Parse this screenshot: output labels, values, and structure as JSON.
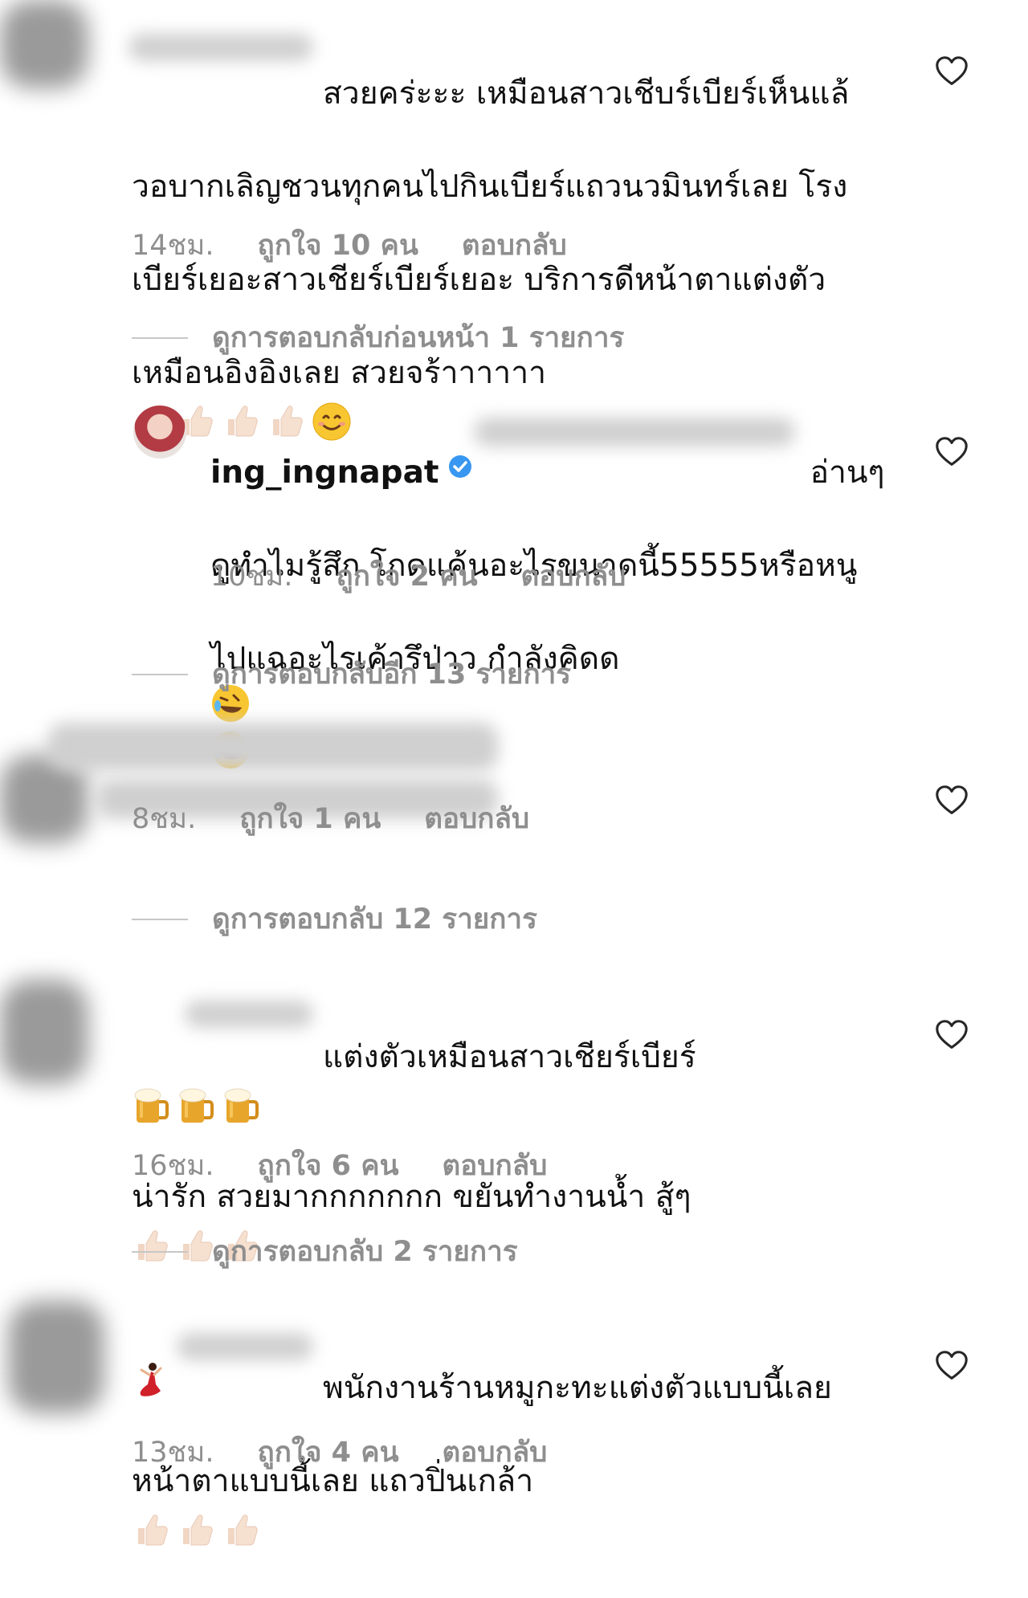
{
  "comments": [
    {
      "line1": "สวยคร่ะะะ เหมือนสาวเชีบร์เบียร์เห็นแล้",
      "line2": "วอบากเลิญชวนทุกคนไปกินเบียร์แถวนวมินทร์เลย โรง",
      "line3": "เบียร์เยอะสาวเชียร์เบียร์เยอะ บริการดีหน้าตาแต่งตัว",
      "line4": "เหมือนอิงอิงเลย สวยจร้าาาาาา",
      "time": "14ชม.",
      "likes": "ถูกใจ 10 คน",
      "reply": "ตอบกลับ",
      "thread": "ดูการตอบกลับก่อนหน้า 1 รายการ"
    },
    {
      "username": "ing_ingnapat",
      "line1": "อ่านๆ",
      "line2": "ดูทำไมรู้สึก โกดแค้นอะไรขนาดนี้55555หรือหนู",
      "line3": "ไปแฉอะไรเค้ารึป่าว กำลังคิดด",
      "time": "10ชม.",
      "likes": "ถูกใจ 2 คน",
      "reply": "ตอบกลับ",
      "thread": "ดูการตอบกลับอีก 13 รายการ"
    },
    {
      "time": "8ชม.",
      "likes": "ถูกใจ 1 คน",
      "reply": "ตอบกลับ",
      "thread": "ดูการตอบกลับ 12 รายการ"
    },
    {
      "line1": "แต่งตัวเหมือนสาวเชียร์เบียร์",
      "line2": "น่ารัก สวยมากกกกกกก ขยันทำงานน้ำ สู้ๆ",
      "time": "16ชม.",
      "likes": "ถูกใจ 6 คน",
      "reply": "ตอบกลับ",
      "thread": "ดูการตอบกลับ 2 รายการ"
    },
    {
      "line1": "พนักงานร้านหมูกะทะแต่งตัวแบบนี้เลย",
      "line2": "หน้าตาแบบนี้เลย แถวปิ่นเกล้า",
      "time": "13ชม.",
      "likes": "ถูกใจ 4 คน",
      "reply": "ตอบกลับ"
    }
  ],
  "icons": {
    "heart": "heart-outline-icon",
    "thumb": "thumbs-up-emoji",
    "beer": "beer-mug-emoji",
    "laugh": "rolling-laughing-emoji",
    "smile": "smiling-face-emoji",
    "verified": "verified-badge-icon"
  },
  "colors": {
    "meta_gray": "#8e8e8e",
    "verified_blue": "#3897f0"
  }
}
